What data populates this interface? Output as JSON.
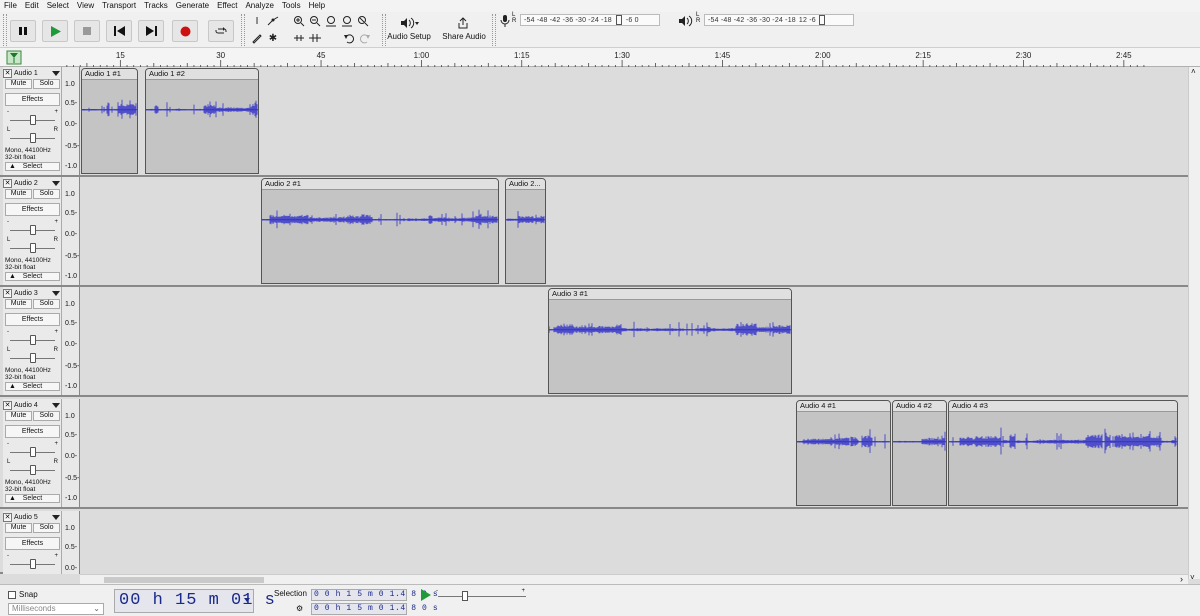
{
  "menu": [
    "File",
    "Edit",
    "Select",
    "View",
    "Transport",
    "Tracks",
    "Generate",
    "Effect",
    "Analyze",
    "Tools",
    "Help"
  ],
  "toolbar": {
    "audio_setup": "Audio Setup",
    "share_audio": "Share Audio",
    "meter_rec_scale": "-54 -48 -42 -36 -30 -24 -18",
    "meter_rec_end": "-6  0",
    "meter_play_scale": "-54 -48 -42 -36 -30 -24 -18",
    "meter_play_end": "12  -6",
    "rec_channels": "L\nR",
    "play_channels": "L\nR"
  },
  "ruler": {
    "labels": [
      "15",
      "30",
      "45",
      "1:00",
      "1:15",
      "1:30",
      "1:45",
      "2:00",
      "2:15",
      "2:30",
      "2:45"
    ]
  },
  "tracks": [
    {
      "name": "Audio 1",
      "mute": "Mute",
      "solo": "Solo",
      "effects": "Effects",
      "info1": "Mono, 44100Hz",
      "info2": "32-bit float",
      "select": "Select",
      "scale": [
        "1.0",
        "0.5-",
        "0.0-",
        "-0.5-",
        "-1.0"
      ],
      "clips": [
        {
          "name": "Audio 1 #1"
        },
        {
          "name": "Audio 1 #2"
        }
      ]
    },
    {
      "name": "Audio 2",
      "mute": "Mute",
      "solo": "Solo",
      "effects": "Effects",
      "info1": "Mono, 44100Hz",
      "info2": "32-bit float",
      "select": "Select",
      "scale": [
        "1.0",
        "0.5-",
        "0.0-",
        "-0.5-",
        "-1.0"
      ],
      "clips": [
        {
          "name": "Audio 2 #1"
        },
        {
          "name": "Audio 2..."
        }
      ]
    },
    {
      "name": "Audio 3",
      "mute": "Mute",
      "solo": "Solo",
      "effects": "Effects",
      "info1": "Mono, 44100Hz",
      "info2": "32-bit float",
      "select": "Select",
      "scale": [
        "1.0",
        "0.5-",
        "0.0-",
        "-0.5-",
        "-1.0"
      ],
      "clips": [
        {
          "name": "Audio 3 #1"
        }
      ]
    },
    {
      "name": "Audio 4",
      "mute": "Mute",
      "solo": "Solo",
      "effects": "Effects",
      "info1": "Mono, 44100Hz",
      "info2": "32-bit float",
      "select": "Select",
      "scale": [
        "1.0",
        "0.5-",
        "0.0-",
        "-0.5-",
        "-1.0"
      ],
      "clips": [
        {
          "name": "Audio 4 #1"
        },
        {
          "name": "Audio 4 #2"
        },
        {
          "name": "Audio 4 #3"
        }
      ]
    },
    {
      "name": "Audio 5",
      "mute": "Mute",
      "solo": "Solo",
      "effects": "Effects",
      "scale": [
        "1.0",
        "0.5-",
        "0.0-"
      ]
    }
  ],
  "bottom": {
    "snap": "Snap",
    "unit": "Milliseconds",
    "time": "00 h 15 m 01 s",
    "selection_label": "Selection",
    "sel_start": "0 0 h 1 5 m 0 1.4 8 0 s",
    "sel_end": "0 0 h 1 5 m 0 1.4 8 0 s"
  },
  "colors": {
    "waveform": "#3232c8",
    "record": "#cc1111",
    "play": "#1e9a3a",
    "clip_body": "#c4c4c4"
  }
}
